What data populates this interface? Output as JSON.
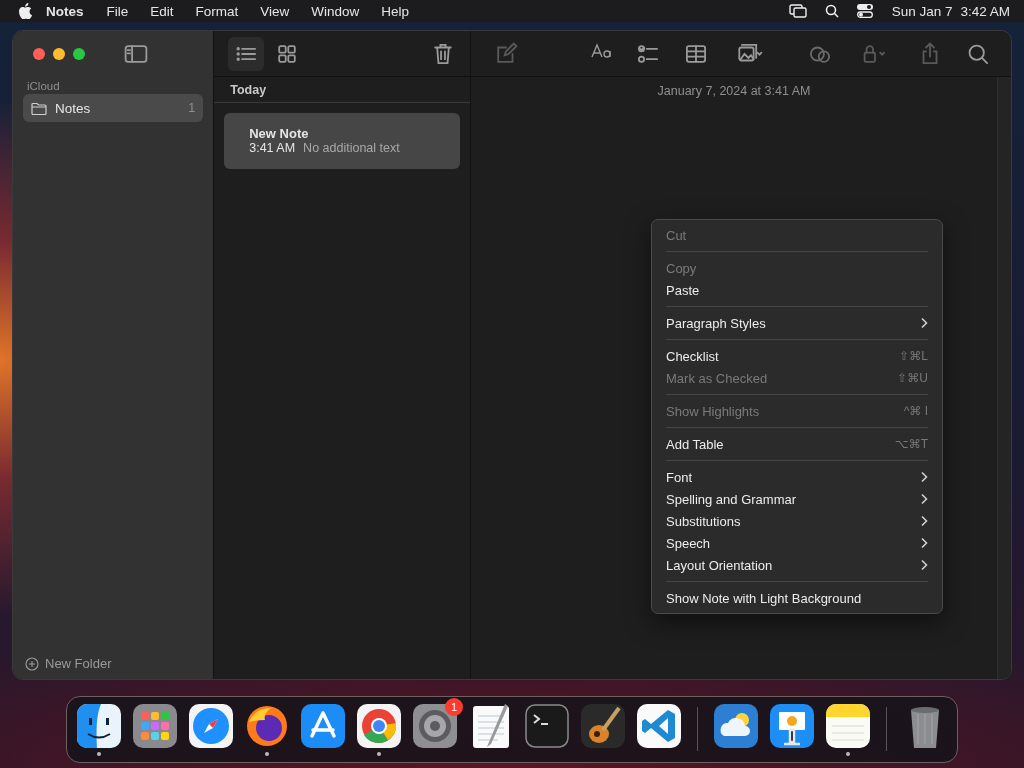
{
  "menu_bar": {
    "app_name": "Notes",
    "menus": [
      "File",
      "Edit",
      "Format",
      "View",
      "Window",
      "Help"
    ],
    "date": "Sun Jan 7",
    "time": "3:42 AM"
  },
  "sidebar": {
    "section": "iCloud",
    "folders": [
      {
        "name": "Notes",
        "count": "1",
        "selected": true
      }
    ],
    "new_folder": "New Folder"
  },
  "note_list": {
    "group": "Today",
    "notes": [
      {
        "title": "New Note",
        "time": "3:41 AM",
        "preview": "No additional text",
        "selected": true
      }
    ]
  },
  "editor": {
    "date": "January 7, 2024 at 3:41 AM"
  },
  "context_menu": {
    "groups": [
      [
        {
          "label": "Cut",
          "disabled": true
        }
      ],
      [
        {
          "label": "Copy",
          "disabled": true
        },
        {
          "label": "Paste",
          "disabled": false
        }
      ],
      [
        {
          "label": "Paragraph Styles",
          "disabled": false,
          "submenu": true
        }
      ],
      [
        {
          "label": "Checklist",
          "disabled": false,
          "shortcut": "⇧⌘L"
        },
        {
          "label": "Mark as Checked",
          "disabled": true,
          "shortcut": "⇧⌘U"
        }
      ],
      [
        {
          "label": "Show Highlights",
          "disabled": true,
          "shortcut": "^⌘ I"
        }
      ],
      [
        {
          "label": "Add Table",
          "disabled": false,
          "shortcut": "⌥⌘T"
        }
      ],
      [
        {
          "label": "Font",
          "disabled": false,
          "submenu": true
        },
        {
          "label": "Spelling and Grammar",
          "disabled": false,
          "submenu": true
        },
        {
          "label": "Substitutions",
          "disabled": false,
          "submenu": true
        },
        {
          "label": "Speech",
          "disabled": false,
          "submenu": true
        },
        {
          "label": "Layout Orientation",
          "disabled": false,
          "submenu": true
        }
      ],
      [
        {
          "label": "Show Note with Light Background",
          "disabled": false
        }
      ]
    ]
  },
  "dock": {
    "groups": [
      [
        {
          "kind": "finder",
          "running": true
        },
        {
          "kind": "launchpad",
          "running": false
        },
        {
          "kind": "safari",
          "running": false
        },
        {
          "kind": "firefox",
          "running": true
        },
        {
          "kind": "appstore",
          "running": false
        },
        {
          "kind": "chrome",
          "running": true
        },
        {
          "kind": "settings",
          "running": false,
          "badge": "1"
        },
        {
          "kind": "textedit",
          "running": false
        },
        {
          "kind": "terminal",
          "running": false
        },
        {
          "kind": "garageband",
          "running": false
        },
        {
          "kind": "vscode",
          "running": false
        }
      ],
      [
        {
          "kind": "weather",
          "running": false
        },
        {
          "kind": "keynote",
          "running": false
        },
        {
          "kind": "notes",
          "running": true
        }
      ],
      [
        {
          "kind": "trash",
          "running": false
        }
      ]
    ]
  }
}
